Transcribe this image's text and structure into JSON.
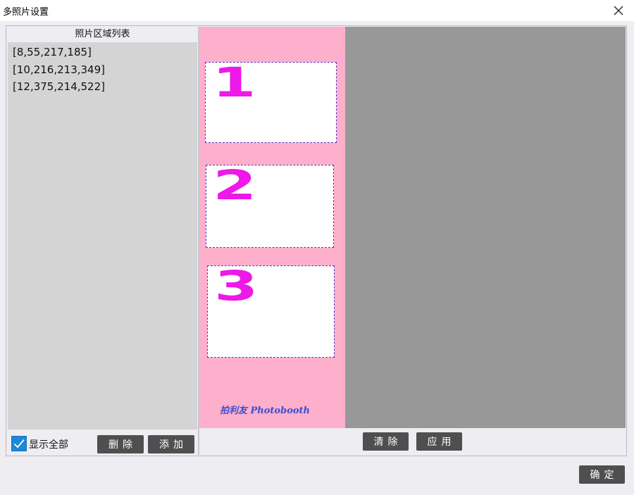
{
  "window": {
    "title": "多照片设置"
  },
  "region_list": {
    "header": "照片区域列表",
    "items": [
      "[8,55,217,185]",
      "[10,216,213,349]",
      "[12,375,214,522]"
    ]
  },
  "canvas": {
    "slots": [
      "1",
      "2",
      "3"
    ],
    "watermark": "拍利友 Photobooth"
  },
  "controls": {
    "show_all_label": "显示全部",
    "show_all_checked": true,
    "delete_label": "删除",
    "add_label": "添加",
    "clear_label": "清除",
    "apply_label": "应用",
    "confirm_label": "确定"
  },
  "colors": {
    "accent": "#1d88d8",
    "button_bg": "#4f4f4f",
    "slot_number": "#ee18e8",
    "canvas_bg": "#fdafcb"
  }
}
